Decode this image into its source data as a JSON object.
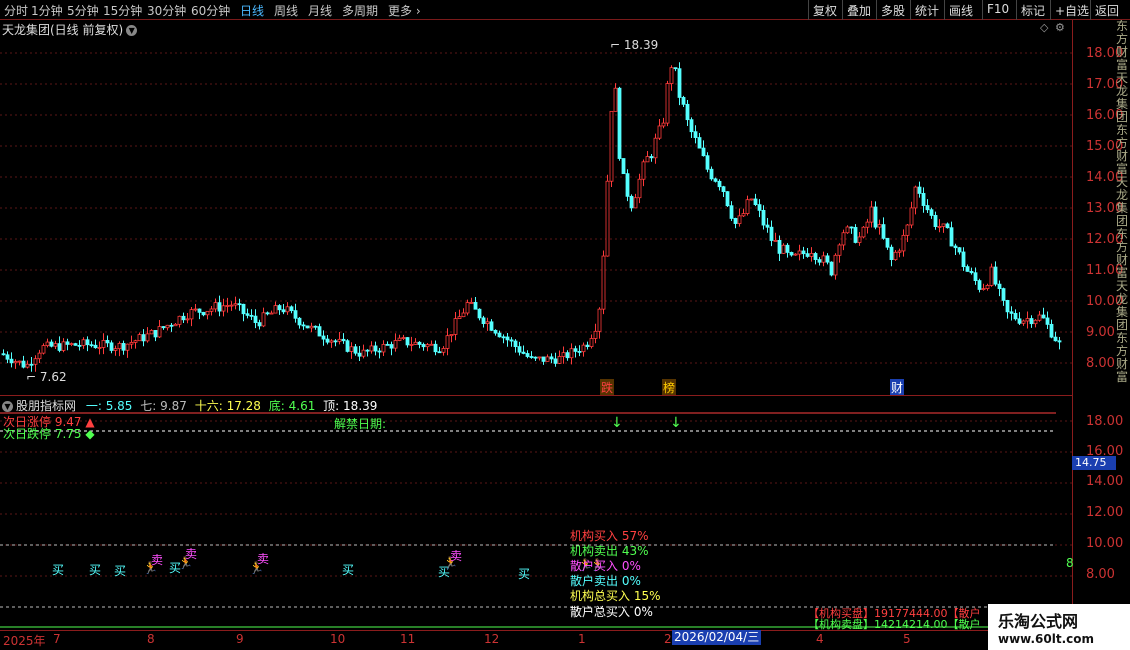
{
  "toolbar": {
    "periods": [
      "分时",
      "1分钟",
      "5分钟",
      "15分钟",
      "30分钟",
      "60分钟",
      "日线",
      "周线",
      "月线",
      "多周期",
      "更多"
    ],
    "active_period": "日线",
    "buttons": [
      "复权",
      "叠加",
      "多股",
      "统计",
      "画线",
      "F10",
      "标记",
      "+自选",
      "返回"
    ]
  },
  "title": "天龙集团(日线 前复权)",
  "main_chart": {
    "high_label": "18.39",
    "low_label": "7.62",
    "event_markers": [
      "跌",
      "榜",
      "财"
    ],
    "axis_labels": [
      "18.00",
      "17.00",
      "16.00",
      "15.00",
      "14.00",
      "13.00",
      "12.00",
      "11.00",
      "10.00",
      "9.00",
      "8.00"
    ],
    "colors": {
      "up": "#ff3a3a",
      "down": "#54ffff"
    }
  },
  "sub_chart": {
    "name": "股朋指标网",
    "values": [
      {
        "label": "一:",
        "value": "5.85",
        "color": "#54ffff"
      },
      {
        "label": "七:",
        "value": "9.87",
        "color": "#bbbbbb"
      },
      {
        "label": "十六:",
        "value": "17.28",
        "color": "#ffff50"
      },
      {
        "label": "底:",
        "value": "4.61",
        "color": "#50ff50"
      },
      {
        "label": "顶:",
        "value": "18.39",
        "color": "#ffffff"
      }
    ],
    "next_limit_up": "次日涨停 9.47",
    "next_limit_down": "次日跌停 7.75",
    "unlock_label": "解禁日期:",
    "axis_labels": [
      "18.00",
      "16.00",
      "14.00",
      "12.00",
      "10.00",
      "8.00"
    ],
    "current_price": "14.75",
    "buy_label": "买",
    "sell_label": "卖",
    "stats": [
      {
        "text": "机构买入 57%",
        "color": "#ff4040"
      },
      {
        "text": "机构卖出 43%",
        "color": "#50ff50"
      },
      {
        "text": "散户买入 0%",
        "color": "#ff50ff"
      },
      {
        "text": "散户卖出 0%",
        "color": "#54ffff"
      },
      {
        "text": "机构总买入 15%",
        "color": "#ffff50"
      },
      {
        "text": "散户总买入 0%",
        "color": "#ffffff"
      }
    ],
    "inst_buy": "【机构买盘】19177444.00【散户",
    "inst_sell": "【机构卖盘】14214214.00【散户",
    "side_number": "8"
  },
  "date_axis": {
    "year": "2025年",
    "months": [
      "7",
      "8",
      "9",
      "10",
      "11",
      "12",
      "1",
      "2",
      "4",
      "5"
    ],
    "cursor_date": "2026/02/04/三"
  },
  "right_strip": "东方财富天龙集团东方财富天龙集团东方财富天龙集团东方财富",
  "watermark": {
    "title": "乐淘公式网",
    "url": "www.60lt.com"
  }
}
